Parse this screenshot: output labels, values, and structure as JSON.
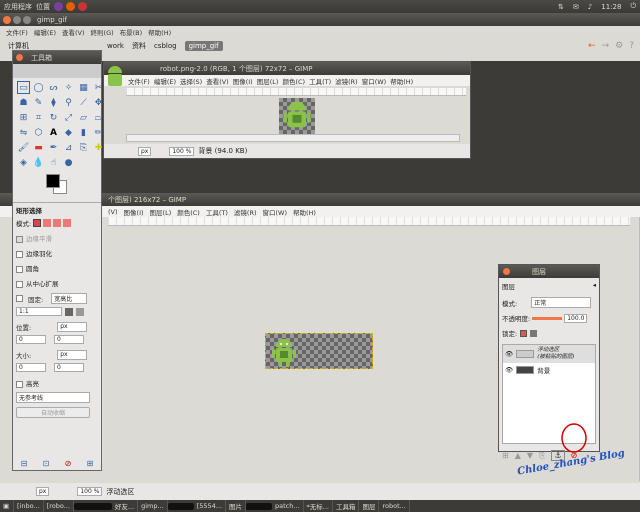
{
  "topbar": {
    "app_menu": "应用程序",
    "places": "位置",
    "clock": "11:28"
  },
  "gimp_window": {
    "title": "gimp_gif",
    "menu": [
      "文件(F)",
      "编辑(E)",
      "查看(V)",
      "終則(G)",
      "布景(B)",
      "帮助(H)"
    ],
    "tabs": [
      "计算机",
      "work",
      "资料",
      "csblog",
      "gimp_gif"
    ]
  },
  "toolbox": {
    "title": "工具箱",
    "options_title": "矩形选择",
    "mode_label": "模式:",
    "antialias": "边缘平滑",
    "feather": "边缘羽化",
    "rounded": "圆角",
    "expand_center": "从中心扩展",
    "fixed_label": "固定:",
    "fixed_value": "宽高比",
    "ratio_value": "1:1",
    "position_label": "位置:",
    "size_label": "大小:",
    "unit": "px",
    "zero": "0",
    "highlight": "高亮",
    "guides": "无参考线",
    "auto_shrink": "自动收缩"
  },
  "robot_window": {
    "title": "robot.png-2.0 (RGB, 1 个图层) 72x72 – GIMP",
    "menu": [
      "文件(F)",
      "编辑(E)",
      "选择(S)",
      "查看(V)",
      "图像(I)",
      "图层(L)",
      "颜色(C)",
      "工具(T)",
      "滤镜(R)",
      "窗口(W)",
      "帮助(H)"
    ],
    "unit": "px",
    "zoom": "100 %",
    "status": "背景 (94.0 KB)"
  },
  "gif_window": {
    "title": "个图层) 216x72 – GIMP",
    "menu": [
      "(V)",
      "图像(I)",
      "图层(L)",
      "颜色(C)",
      "工具(T)",
      "滤镜(R)",
      "窗口(W)",
      "帮助(H)"
    ],
    "unit": "px",
    "zoom": "100 %",
    "status": "浮动选区"
  },
  "layers_dialog": {
    "title": "图层",
    "tab": "图层",
    "mode_label": "模式:",
    "mode_value": "正常",
    "opacity_label": "不透明度:",
    "opacity_value": "100.0",
    "lock_label": "锁定:",
    "layer1_name": "浮动选区",
    "layer1_sub": "(被粘贴的图层)",
    "layer2_name": "背景"
  },
  "watermark": "Chloe_zhang's Blog",
  "taskbar": [
    "[inbo...",
    "[robo...",
    "好友...",
    "gimp...",
    "[5554...",
    "图片",
    "patch...",
    "*无标...",
    "工具箱",
    "图层",
    "robot..."
  ],
  "colors": {
    "accent": "#f07746",
    "annotation": "#d40000"
  }
}
